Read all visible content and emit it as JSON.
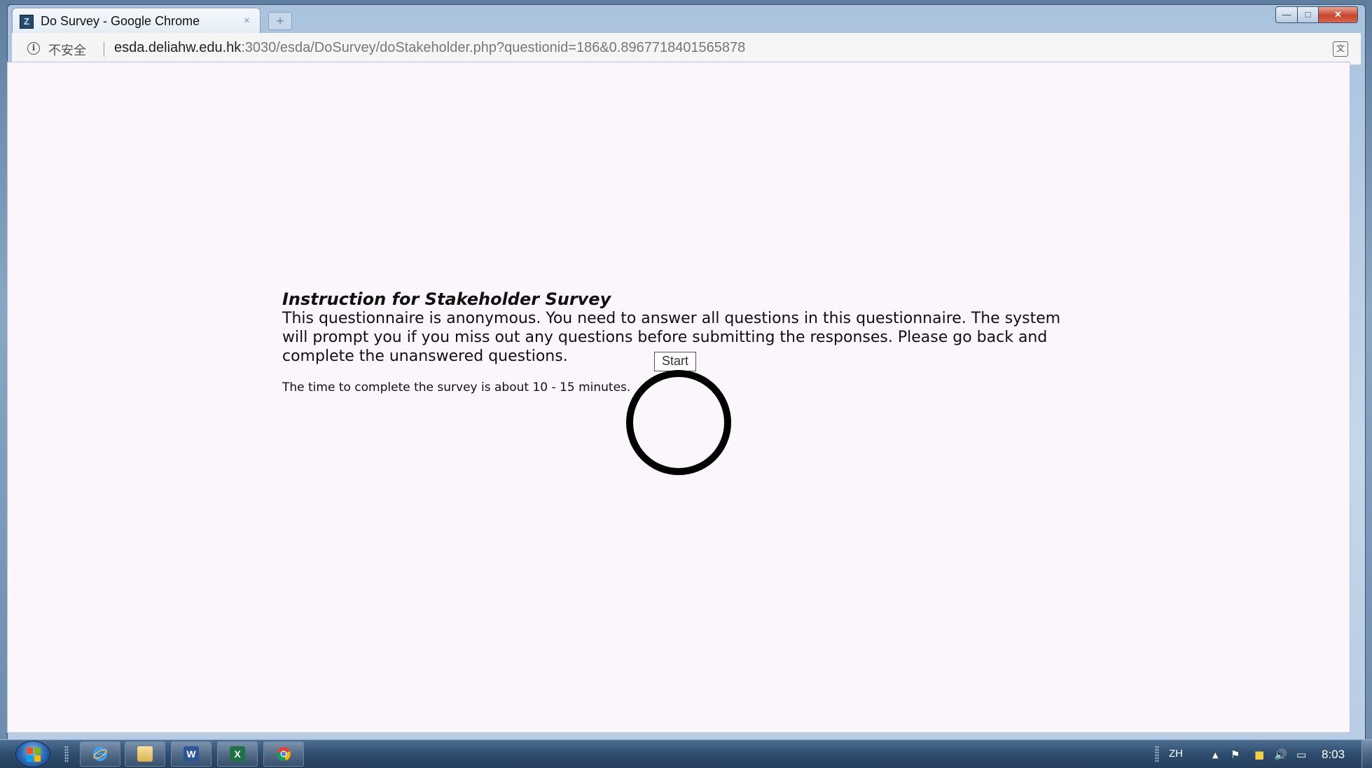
{
  "window": {
    "tab_title": "Do Survey - Google Chrome",
    "tab_close": "×",
    "new_tab": "+",
    "controls": {
      "minimize": "—",
      "maximize": "□",
      "close": "✕"
    }
  },
  "address_bar": {
    "security_label": "不安全",
    "url_host": "esda.deliahw.edu.hk",
    "url_rest": ":3030/esda/DoSurvey/doStakeholder.php?questionid=186&0.8967718401565878"
  },
  "page": {
    "title": "Instruction for Stakeholder Survey",
    "body": "This questionnaire is anonymous. You need to answer all questions in this questionnaire. The system will prompt you if you miss out any questions before submitting the responses. Please go back and complete the unanswered questions.",
    "time_note": "The time to complete the survey is about 10 - 15 minutes.",
    "start_button": "Start"
  },
  "taskbar": {
    "apps": [
      "internet-explorer",
      "file-explorer",
      "word",
      "excel",
      "chrome"
    ],
    "word_glyph": "W",
    "excel_glyph": "X",
    "language": "ZH",
    "clock": "8:03"
  }
}
